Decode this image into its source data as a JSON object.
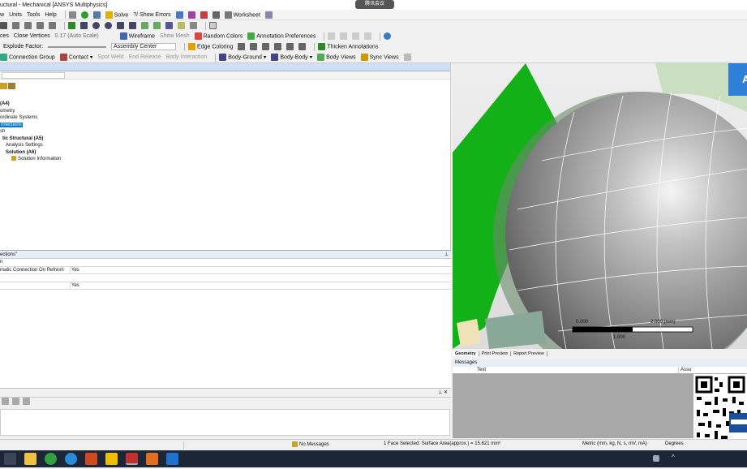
{
  "window": {
    "title": "uctural - Mechanical [ANSYS Multiphysics]",
    "overlay_label": "腾讯会议"
  },
  "menu": [
    "w",
    "Units",
    "Tools",
    "Help"
  ],
  "toolbar1": {
    "solve": "Solve",
    "show_errors": "?/ Show Errors",
    "worksheet": "Worksheet"
  },
  "toolbar2": {
    "ces": "ces",
    "close_vertices": "Close Vertices",
    "auto_scale": "0.17 (Auto Scale)",
    "wireframe": "Wireframe",
    "show_mesh": "Show Mesh",
    "random_colors": "Random Colors",
    "annotation_prefs": "Annotation Preferences"
  },
  "toolbar3": {
    "explode_factor": "Explode Factor:",
    "assembly_center": "Assembly Center",
    "edge_coloring": "Edge Coloring",
    "thicken_annotations": "Thicken Annotations"
  },
  "toolbar4": {
    "connection_group": "Connection Group",
    "contact": "Contact",
    "spot_weld": "Spot Weld",
    "end_release": "End Release",
    "body_interaction": "Body Interaction",
    "body_ground": "Body-Ground",
    "body_body": "Body-Body",
    "body_views": "Body Views",
    "sync_views": "Sync Views"
  },
  "tree": [
    "(A4)",
    "ometry",
    "ordinate Systems",
    "nnections",
    "sh",
    "tic Structural (A5)",
    "Analysis Settings",
    "Solution (A6)",
    "Solution Information"
  ],
  "details": {
    "title": "ections\"",
    "rows": [
      {
        "k": "n",
        "v": ""
      },
      {
        "k": "matic Connection On Refresh",
        "v": "Yes"
      },
      {
        "k": "",
        "v": ""
      },
      {
        "k": "",
        "v": "Yes"
      }
    ]
  },
  "graphics": {
    "corner_letter": "A",
    "scale_left": "0.000",
    "scale_right": "2.000 (mm)",
    "scale_mid": "1.000"
  },
  "graphics_tabs": [
    "Geometry",
    "Print Preview",
    "Report Preview"
  ],
  "messages": {
    "title": "Messages",
    "col_text": "Text",
    "col_assoc": "Asso"
  },
  "status": {
    "no_messages": "No Messages",
    "selection": "1 Face Selected: Surface Area(approx.) = 15.621 mm²",
    "units": "Metric (mm, kg, N, s, mV, mA)",
    "degrees": "Degrees"
  },
  "colors": {
    "accent": "#0078d7",
    "green": "#13b117",
    "sphere": "#8a8a8a"
  }
}
